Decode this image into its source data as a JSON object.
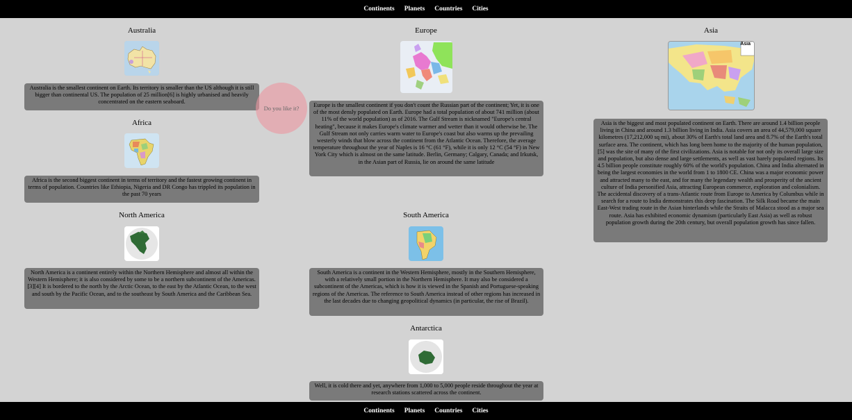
{
  "nav": {
    "items": [
      "Continents",
      "Planets",
      "Countries",
      "Cities"
    ]
  },
  "bubble": {
    "text": "Do you like it?"
  },
  "continents": {
    "australia": {
      "title": "Australia",
      "text": "Australia is the smallest continent on Earth. Its territory is smaller than the US although it is still bigger than continental US. The population of 25 million[6] is highly urbanised and heavily concentrated on the eastern seaboard."
    },
    "africa": {
      "title": "Africa",
      "text": "Africa is the second biggest continent in terms of territory and the fastest growing continent in terms of population. Countries like Ethiopia, Nigeria and DR Congo has trippled its population in the past 70 years"
    },
    "north_america": {
      "title": "North America",
      "text": "North America is a continent entirely within the Northern Hemisphere and almost all within the Western Hemisphere; it is also considered by some to be a northern subcontinent of the Americas.[3][4] It is bordered to the north by the Arctic Ocean, to the east by the Atlantic Ocean, to the west and south by the Pacific Ocean, and to the southeast by South America and the Caribbean Sea."
    },
    "europe": {
      "title": "Europe",
      "text": "Europe is the smallest continent if you don't count the Russian part of the continent; Yet, it is one of the most densly populated on Earth. Europe had a total population of about 741 million (about 11% of the world population) as of 2016. The Gulf Stream is nicknamed \"Europe's central heating\", because it makes Europe's climate warmer and wetter than it would otherwise be. The Gulf Stream not only carries warm water to Europe's coast but also warms up the prevailing westerly winds that blow across the continent from the Atlantic Ocean. Therefore, the average temperature throughout the year of Naples is 16 °C (61 °F), while it is only 12 °C (54 °F) in New York City which is almost on the same latitude. Berlin, Germany; Calgary, Canada; and Irkutsk, in the Asian part of Russia, lie on around the same latitude"
    },
    "south_america": {
      "title": "South America",
      "text": "South America is a continent in the Western Hemisphere, mostly in the Southern Hemisphere, with a relatively small portion in the Northern Hemisphere. It may also be considered a subcontinent of the Americas, which is how it is viewed in the Spanish and Portuguese-speaking regions of the Americas. The reference to South America instead of other regions has increased in the last decades due to changing geopolitical dynamics (in particular, the rise of Brazil)."
    },
    "antarctica": {
      "title": "Antarctica",
      "text": "Well, it is cold there and yet, anywhere from 1,000 to 5,000 people reside throughout the year at research stations scattered across the continent."
    },
    "asia": {
      "title": "Asia",
      "map_label": "Asia",
      "text": "Asia is the biggest and most populated continent on Earth. There are around 1.4 billion people living in China and around 1.3 billion living in India. Asia covers an area of 44,579,000 square kilometres (17,212,000 sq mi), about 30% of Earth's total land area and 8.7% of the Earth's total surface area. The continent, which has long been home to the majority of the human population,[5] was the site of many of the first civilizations. Asia is notable for not only its overall large size and population, but also dense and large settlements, as well as vast barely populated regions. Its 4.5 billion people constitute roughly 60% of the world's population. China and India alternated in being the largest economies in the world from 1 to 1800 CE. China was a major economic power and attracted many to the east, and for many the legendary wealth and prosperity of the ancient culture of India personified Asia, attracting European commerce, exploration and colonialism. The accidental discovery of a trans-Atlantic route from Europe to America by Columbus while in search for a route to India demonstrates this deep fascination. The Silk Road became the main East-West trading route in the Asian hinterlands while the Straits of Malacca stood as a major sea route. Asia has exhibited economic dynamism (particularly East Asia) as well as robust population growth during the 20th century, but overall population growth has since fallen."
    }
  }
}
